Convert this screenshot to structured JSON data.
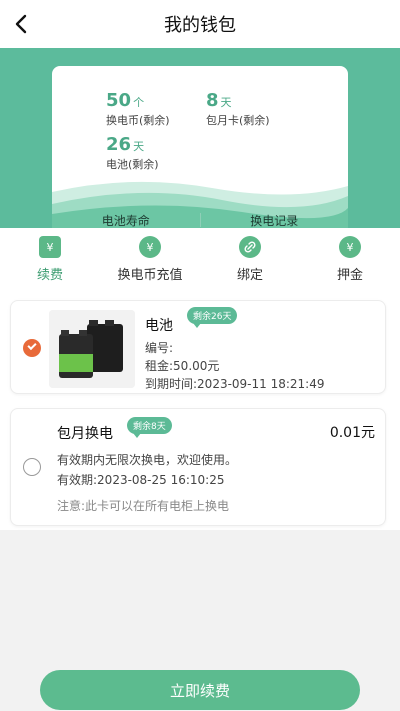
{
  "header": {
    "title": "我的钱包"
  },
  "summary": {
    "coins": {
      "value": "50",
      "unit": "个",
      "label": "换电币(剩余)"
    },
    "monthly": {
      "value": "8",
      "unit": "天",
      "label": "包月卡(剩余)"
    },
    "battery": {
      "value": "26",
      "unit": "天",
      "label": "电池(剩余)"
    },
    "links": {
      "life": "电池寿命",
      "records": "换电记录"
    }
  },
  "tabs": [
    {
      "label": "续费",
      "icon": "renew-icon"
    },
    {
      "label": "换电币充值",
      "icon": "yuan-coin-icon"
    },
    {
      "label": "绑定",
      "icon": "link-icon"
    },
    {
      "label": "押金",
      "icon": "money-bag-icon"
    }
  ],
  "items": [
    {
      "name": "电池",
      "badge": "剩余26天",
      "code": "编号:",
      "rent": "租金:50.00元",
      "expire": "到期时间:2023-09-11 18:21:49",
      "checked": true
    },
    {
      "name": "包月换电",
      "badge": "剩余8天",
      "price": "0.01元",
      "desc": "有效期内无限次换电，欢迎使用。",
      "validity": "有效期:2023-08-25 16:10:25",
      "note": "注意:此卡可以在所有电柜上换电",
      "checked": false
    }
  ],
  "footer": {
    "cta": "立即续费"
  },
  "colors": {
    "primary": "#5cbb9c",
    "accent": "#4aa887",
    "check": "#e86a3a"
  }
}
